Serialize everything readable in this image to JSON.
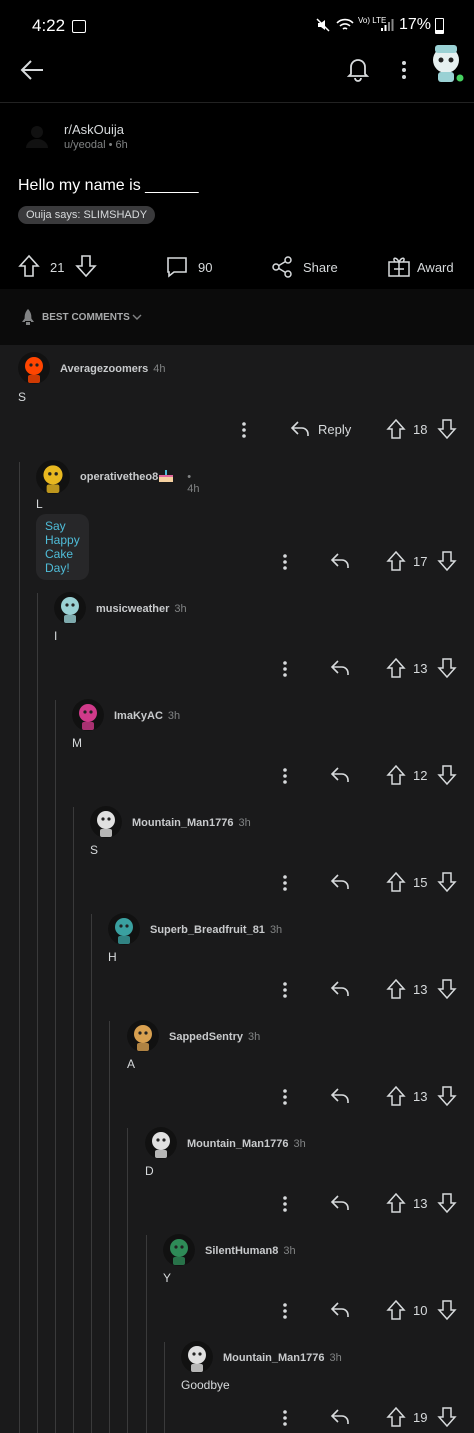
{
  "status": {
    "time": "4:22",
    "battery": "17%",
    "network": "Vo) LTE"
  },
  "post": {
    "subreddit": "r/AskOuija",
    "author": "u/yeodal",
    "age": "6h",
    "author_line": "u/yeodal • 6h",
    "title": "Hello my name is ______",
    "flair": "Ouija says: SLIMSHADY",
    "upvotes": "21",
    "comments": "90",
    "share_label": "Share",
    "award_label": "Award"
  },
  "sort": {
    "label": "BEST COMMENTS"
  },
  "comments": [
    {
      "user": "Averagezoomers",
      "time": "4h",
      "text": "S",
      "score": "18",
      "reply_label": "Reply",
      "avatar_color": "#ff4500"
    },
    {
      "user": "operativetheo8",
      "time": "• 4h",
      "text": "L",
      "score": "17",
      "cake": "Say Happy Cake Day!",
      "avatar_color": "#e8b820"
    },
    {
      "user": "musicweather",
      "time": "3h",
      "text": "I",
      "score": "13",
      "avatar_color": "#9ad1d4"
    },
    {
      "user": "ImaKyAC",
      "time": "3h",
      "text": "M",
      "score": "12",
      "avatar_color": "#d03a8a"
    },
    {
      "user": "Mountain_Man1776",
      "time": "3h",
      "text": "S",
      "score": "15",
      "avatar_color": "#e0e0e0"
    },
    {
      "user": "Superb_Breadfruit_81",
      "time": "3h",
      "text": "H",
      "score": "13",
      "avatar_color": "#3aa0a0"
    },
    {
      "user": "SappedSentry",
      "time": "3h",
      "text": "A",
      "score": "13",
      "avatar_color": "#d8a050"
    },
    {
      "user": "Mountain_Man1776",
      "time": "3h",
      "text": "D",
      "score": "13",
      "avatar_color": "#e0e0e0"
    },
    {
      "user": "SilentHuman8",
      "time": "3h",
      "text": "Y",
      "score": "10",
      "avatar_color": "#2e8b57"
    },
    {
      "user": "Mountain_Man1776",
      "time": "3h",
      "text": "Goodbye",
      "score": "19",
      "avatar_color": "#e0e0e0"
    }
  ]
}
